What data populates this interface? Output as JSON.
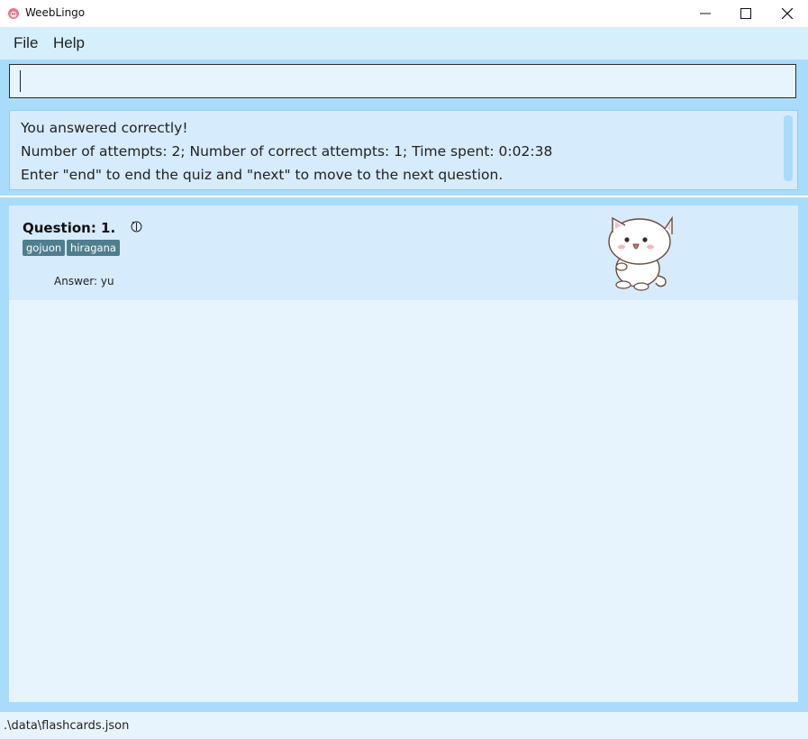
{
  "window": {
    "title": "WeebLingo",
    "controls": {
      "minimize_icon": "minimize-icon",
      "maximize_icon": "maximize-icon",
      "close_icon": "close-icon"
    }
  },
  "menu": {
    "file": "File",
    "help": "Help"
  },
  "command": {
    "value": "",
    "placeholder": ""
  },
  "result": {
    "line1": "You answered correctly!",
    "line2": "Number of attempts: 2; Number of correct attempts: 1; Time spent: 0:02:38",
    "line3": "Enter \"end\" to end the quiz and \"next\" to move to the next question."
  },
  "card": {
    "question": "Question: 1.",
    "tags": [
      "gojuon",
      "hiragana"
    ],
    "answer": "Answer: yu",
    "timer_icon": "timer-icon",
    "mascot": "cat-mascot"
  },
  "status": {
    "path": ".\\data\\flashcards.json"
  },
  "colors": {
    "menubar": "#d6effd",
    "frame": "#a9dcfb",
    "panel": "#e7f3fd",
    "card": "#d6ebfb",
    "tag": "#4f7e8e"
  }
}
